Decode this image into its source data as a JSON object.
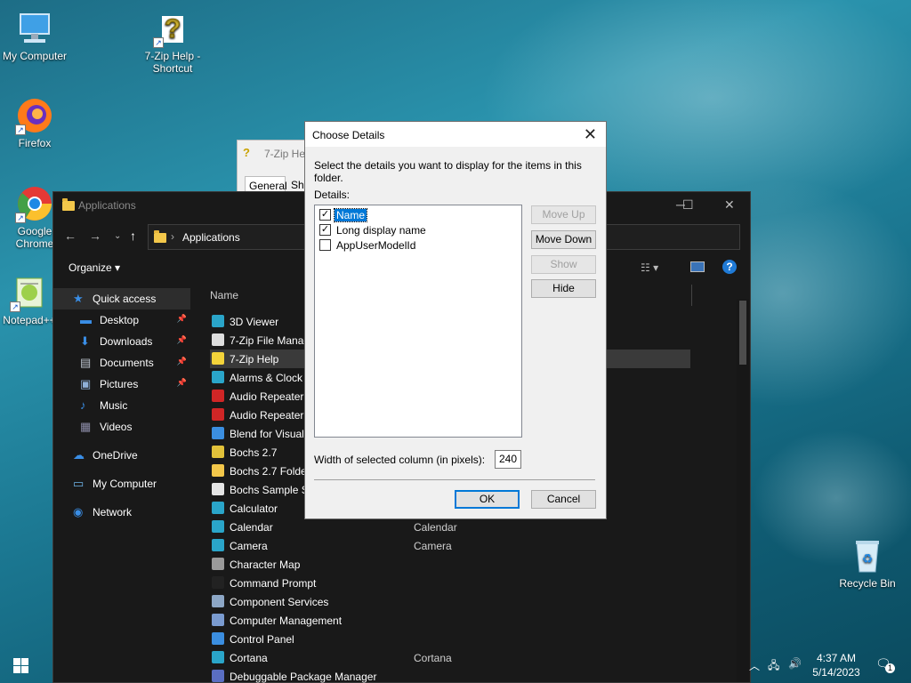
{
  "desktop": {
    "icons": [
      {
        "label": "My Computer",
        "icon": "computer-icon"
      },
      {
        "label": "7-Zip Help - Shortcut",
        "icon": "help-icon"
      },
      {
        "label": "Firefox",
        "icon": "firefox-icon"
      },
      {
        "label": "Google Chrome",
        "icon": "chrome-icon"
      },
      {
        "label": "Notepad++",
        "icon": "notepad-icon"
      },
      {
        "label": "Recycle Bin",
        "icon": "recycle-bin-icon"
      }
    ]
  },
  "explorer": {
    "title": "Applications",
    "address": "Applications",
    "organize": "Organize",
    "column_name": "Name",
    "nav": [
      {
        "label": "Quick access",
        "icon": "star-icon",
        "pinned": false
      },
      {
        "label": "Desktop",
        "icon": "desktop-icon",
        "pinned": true
      },
      {
        "label": "Downloads",
        "icon": "download-icon",
        "pinned": true
      },
      {
        "label": "Documents",
        "icon": "documents-icon",
        "pinned": true
      },
      {
        "label": "Pictures",
        "icon": "pictures-icon",
        "pinned": true
      },
      {
        "label": "Music",
        "icon": "music-icon",
        "pinned": false
      },
      {
        "label": "Videos",
        "icon": "videos-icon",
        "pinned": false
      },
      {
        "label": "OneDrive",
        "icon": "cloud-icon",
        "pinned": false
      },
      {
        "label": "My Computer",
        "icon": "computer-icon",
        "pinned": false
      },
      {
        "label": "Network",
        "icon": "network-icon",
        "pinned": false
      }
    ],
    "files": [
      {
        "name": "3D Viewer",
        "detail": "",
        "color": "#2aa5c9"
      },
      {
        "name": "7-Zip File Manag",
        "detail": "",
        "color": "#dddddd"
      },
      {
        "name": "7-Zip Help",
        "detail": "",
        "color": "#f3d33a"
      },
      {
        "name": "Alarms & Clock",
        "detail": "",
        "color": "#2aa5c9"
      },
      {
        "name": "Audio Repeater",
        "detail": "",
        "color": "#d02626"
      },
      {
        "name": "Audio Repeater",
        "detail": "",
        "color": "#d02626"
      },
      {
        "name": "Blend for Visual",
        "detail": "",
        "color": "#3b8ee0"
      },
      {
        "name": "Bochs 2.7",
        "detail": "",
        "color": "#e2c23a"
      },
      {
        "name": "Bochs 2.7 Folder",
        "detail": "",
        "color": "#f3c74a"
      },
      {
        "name": "Bochs Sample S",
        "detail": "",
        "color": "#e5e5e5"
      },
      {
        "name": "Calculator",
        "detail": "",
        "color": "#2aa5c9"
      },
      {
        "name": "Calendar",
        "detail": "Calendar",
        "color": "#2aa5c9"
      },
      {
        "name": "Camera",
        "detail": "Camera",
        "color": "#2aa5c9"
      },
      {
        "name": "Character Map",
        "detail": "",
        "color": "#9a9a9a"
      },
      {
        "name": "Command Prompt",
        "detail": "",
        "color": "#222222"
      },
      {
        "name": "Component Services",
        "detail": "",
        "color": "#8da7c6"
      },
      {
        "name": "Computer Management",
        "detail": "",
        "color": "#7a9bd0"
      },
      {
        "name": "Control Panel",
        "detail": "",
        "color": "#3b8ee0"
      },
      {
        "name": "Cortana",
        "detail": "Cortana",
        "color": "#2aa5c9"
      },
      {
        "name": "Debuggable Package Manager",
        "detail": "",
        "color": "#5a6ec2"
      }
    ]
  },
  "props_window": {
    "title": "7-Zip He",
    "tab1": "General",
    "tab2": "Sh"
  },
  "dialog": {
    "title": "Choose Details",
    "instruction": "Select the details you want to display for the items in this folder.",
    "details_label": "Details:",
    "items": [
      {
        "label": "Name",
        "checked": true,
        "selected": true
      },
      {
        "label": "Long display name",
        "checked": true,
        "selected": false
      },
      {
        "label": "AppUserModelId",
        "checked": false,
        "selected": false
      }
    ],
    "buttons": {
      "move_up": "Move Up",
      "move_down": "Move Down",
      "show": "Show",
      "hide": "Hide",
      "ok": "OK",
      "cancel": "Cancel"
    },
    "width_label": "Width of selected column (in pixels):",
    "width_value": "240"
  },
  "taskbar": {
    "time": "4:37 AM",
    "date": "5/14/2023",
    "notifications": "1"
  }
}
